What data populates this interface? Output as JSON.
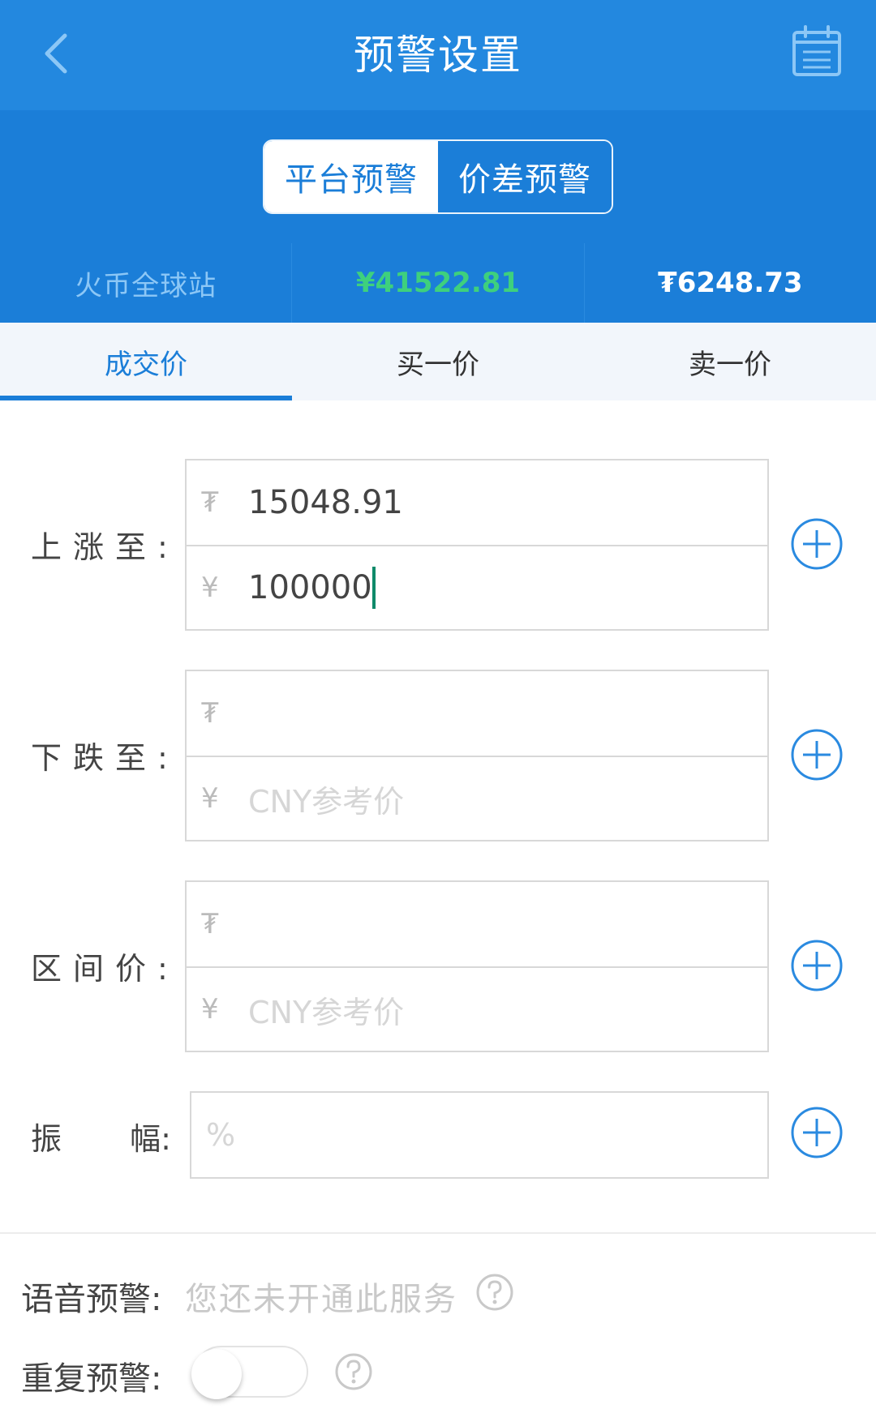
{
  "header": {
    "title": "预警设置",
    "back_icon": "chevron-left-icon",
    "calendar_icon": "calendar-icon"
  },
  "segment": {
    "platform_label": "平台预警",
    "spread_label": "价差预警",
    "active": "platform"
  },
  "price_strip": {
    "exchange": "火币全球站",
    "cny_price": "¥41522.81",
    "usdt_price": "₮6248.73"
  },
  "tabs": [
    {
      "label": "成交价",
      "active": true
    },
    {
      "label": "买一价",
      "active": false
    },
    {
      "label": "卖一价",
      "active": false
    }
  ],
  "form": {
    "rise": {
      "label": "上涨至:",
      "usdt_prefix": "₮",
      "usdt_value": "15048.91",
      "cny_prefix": "¥",
      "cny_value": "100000"
    },
    "fall": {
      "label": "下跌至:",
      "usdt_prefix": "₮",
      "cny_prefix": "¥",
      "cny_placeholder": "CNY参考价"
    },
    "range": {
      "label": "区间价:",
      "usdt_prefix": "₮",
      "cny_prefix": "¥",
      "cny_placeholder": "CNY参考价"
    },
    "amplitude": {
      "label_left": "振",
      "label_right": "幅:",
      "placeholder": "%"
    }
  },
  "voice_alert": {
    "label": "语音预警:",
    "status": "您还未开通此服务"
  },
  "repeat_alert": {
    "label": "重复预警:",
    "enabled": false
  },
  "colors": {
    "primary": "#1b7ed8",
    "header": "#2388df",
    "price_up": "#3ed07d"
  }
}
